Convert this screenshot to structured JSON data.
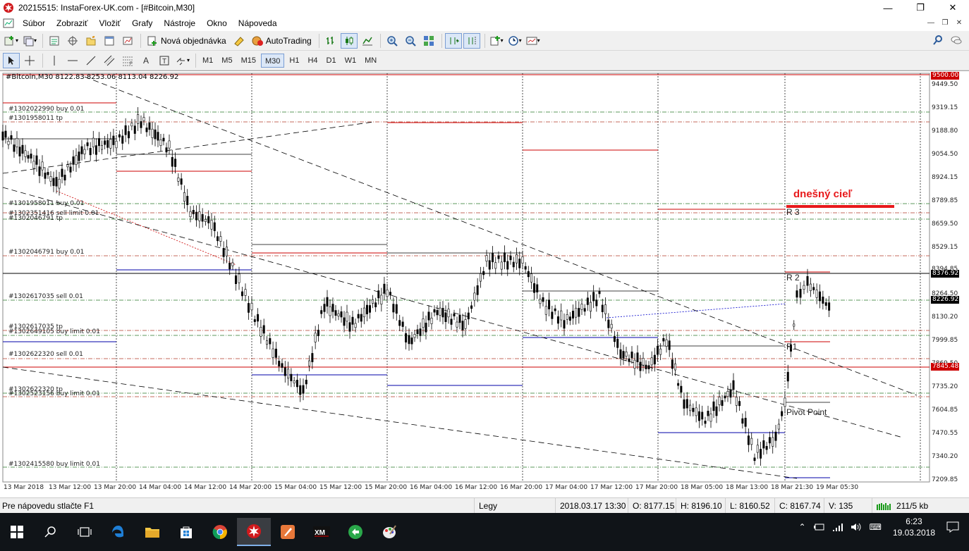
{
  "window": {
    "title": "20215515: InstaForex-UK.com - [#Bitcoin,M30]",
    "minimize": "—",
    "maximize": "❐",
    "close": "✕"
  },
  "menu": [
    "Súbor",
    "Zobraziť",
    "Vložiť",
    "Grafy",
    "Nástroje",
    "Okno",
    "Nápoveda"
  ],
  "toolbar": {
    "new_order_label": "Nová objednávka",
    "autotrading_label": "AutoTrading"
  },
  "timeframes": [
    "M1",
    "M5",
    "M15",
    "M30",
    "H1",
    "H4",
    "D1",
    "W1",
    "MN"
  ],
  "active_timeframe": "M30",
  "chart": {
    "header": "#Bitcoin,M30  8122.83 8253.06 8113.04 8226.92",
    "target_label": "dnešný cieľ",
    "pivot_labels": {
      "r3": "R 3",
      "r2": "R 2",
      "r1": "R1",
      "pp": "Pivot Point"
    },
    "price_axis": [
      "9449.50",
      "9319.15",
      "9188.80",
      "9054.50",
      "8924.15",
      "8789.85",
      "8659.50",
      "8529.15",
      "8394.85",
      "8264.50",
      "8130.20",
      "7999.85",
      "7869.50",
      "7735.20",
      "7604.85",
      "7470.55",
      "7340.20",
      "7209.85"
    ],
    "price_tags": [
      {
        "text": "9500.00",
        "color": "#cc0000"
      },
      {
        "text": "8376.92",
        "color": "#000000"
      },
      {
        "text": "8226.92",
        "color": "#000000"
      },
      {
        "text": "7845.48",
        "color": "#cc0000"
      }
    ],
    "time_axis": [
      "13 Mar 2018",
      "13 Mar 12:00",
      "13 Mar 20:00",
      "14 Mar 04:00",
      "14 Mar 12:00",
      "14 Mar 20:00",
      "15 Mar 04:00",
      "15 Mar 12:00",
      "15 Mar 20:00",
      "16 Mar 04:00",
      "16 Mar 12:00",
      "16 Mar 20:00",
      "17 Mar 04:00",
      "17 Mar 12:00",
      "17 Mar 20:00",
      "18 Mar 05:00",
      "18 Mar 13:00",
      "18 Mar 21:30",
      "19 Mar 05:30"
    ],
    "orders": [
      "#1302022990 buy 0.01",
      "#1301958011 tp",
      "#1301958011 buy 0.01",
      "#1302351416 sell limit 0.01",
      "#1302046791 tp",
      "#1302046791 buy 0.01",
      "#1302617035 sell 0.01",
      "#1302617035 tp",
      "#1302649105 buy limit 0.01",
      "#1302622320 sell 0.01",
      "#1302622320 tp",
      "#1302523156 buy limit 0.01",
      "#1302415580 buy limit 0.01"
    ]
  },
  "status": {
    "help": "Pre nápovedu stlačte F1",
    "profile": "Legy",
    "datetime": "2018.03.17 13:30",
    "open": "O: 8177.15",
    "high": "H: 8196.10",
    "low": "L: 8160.52",
    "close": "C: 8167.74",
    "volume": "V: 135",
    "traffic": "211/5 kb"
  },
  "taskbar": {
    "time": "6:23",
    "date": "19.03.2018"
  }
}
